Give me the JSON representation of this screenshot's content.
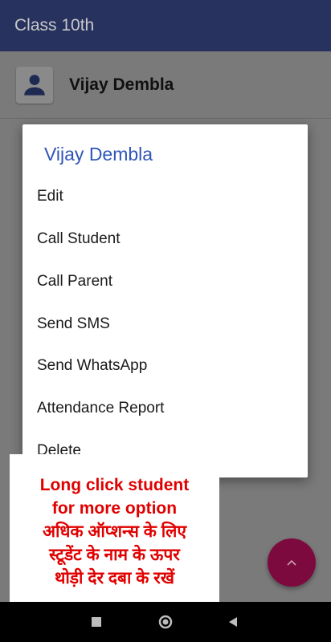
{
  "app": {
    "title": "Class 10th"
  },
  "student": {
    "name": "Vijay Dembla"
  },
  "dialog": {
    "title": "Vijay Dembla",
    "items": [
      {
        "label": "Edit"
      },
      {
        "label": "Call Student"
      },
      {
        "label": "Call Parent"
      },
      {
        "label": "Send SMS"
      },
      {
        "label": "Send WhatsApp"
      },
      {
        "label": "Attendance Report"
      },
      {
        "label": "Delete"
      }
    ]
  },
  "banner": {
    "lines": [
      "Long click student",
      "for more option",
      "अधिक ऑप्शन्स के लिए",
      "स्टूडेंट के नाम के ऊपर",
      "थोड़ी देर दबा के रखें"
    ]
  },
  "fab": {
    "icon": "chevron-up-icon"
  },
  "navbar": {
    "icons": [
      "square-icon",
      "circle-icon",
      "triangle-back-icon"
    ]
  },
  "colors": {
    "appbar": "#27325f",
    "dialog_title": "#2f55b7",
    "banner_text": "#e00000",
    "fab": "#7d0a3e"
  }
}
